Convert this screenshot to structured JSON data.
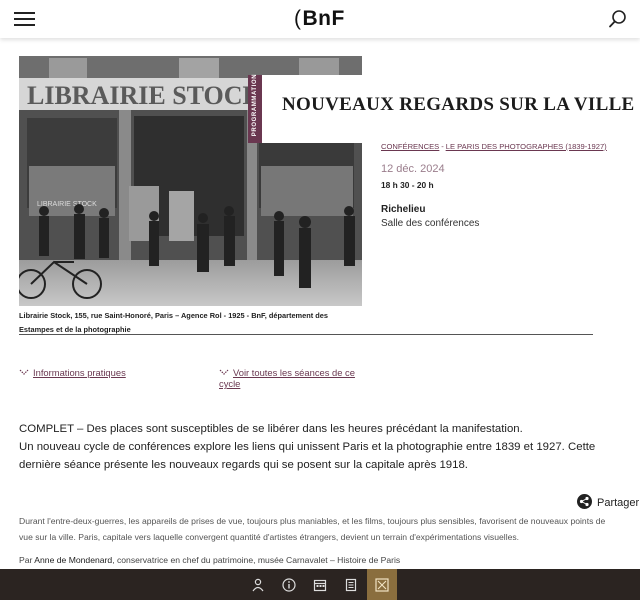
{
  "header": {
    "logo_paren": "(",
    "logo_text": "BnF",
    "menu_icon": "hamburger-icon",
    "search_icon": "search-icon"
  },
  "event": {
    "category_tab": "PROGRAMMATION",
    "title": "NOUVEAUX REGARDS SUR LA VILLE",
    "breadcrumb_1": "CONFÉRENCES",
    "breadcrumb_sep": "-",
    "breadcrumb_2": "LE PARIS DES PHOTOGRAPHES (1839-1927)",
    "date": "12 déc. 2024",
    "time": "18 h 30 - 20 h",
    "venue": "Richelieu",
    "room": "Salle des conférences"
  },
  "photo": {
    "caption": "Librairie Stock, 155, rue Saint-Honoré, Paris – Agence Rol - 1925 - BnF, département des Estampes et de la photographie",
    "sign_text": "LIBRAIRIE STOCK",
    "window_text": "LIBRAIRIE STOCK"
  },
  "links": {
    "info": "Informations pratiques",
    "seances": "Voir toutes les séances de ce cycle"
  },
  "content": {
    "status": "COMPLET – Des places sont susceptibles de se libérer dans les heures précédant la manifestation.",
    "intro": "Un nouveau cycle de conférences explore les liens qui unissent Paris et la photographie entre 1839 et 1927. Cette dernière séance présente les nouveaux regards qui se posent sur la capitale après 1918.",
    "share_label": "Partager",
    "description": "Durant l'entre-deux-guerres, les appareils de prises de vue, toujours plus maniables, et les films, toujours plus sensibles, favorisent de nouveaux points de vue sur la ville. Paris, capitale vers laquelle convergent quantité d'artistes étrangers, devient un terrain d'expérimentations visuelles.",
    "author_prefix": "Par",
    "author_name": "Anne de Mondenard",
    "author_suffix": ", conservatrice en chef du patrimoine, musée Carnavalet – Histoire de Paris"
  },
  "toolbar": {
    "items": [
      "visitor-icon",
      "info-icon",
      "calendar-icon",
      "catalogue-icon",
      "library-icon"
    ],
    "active_index": 4,
    "active_color": "#8a6e3e",
    "bg_color": "#2b2421"
  },
  "colors": {
    "accent": "#6a3750",
    "date": "#9a7d8c"
  }
}
